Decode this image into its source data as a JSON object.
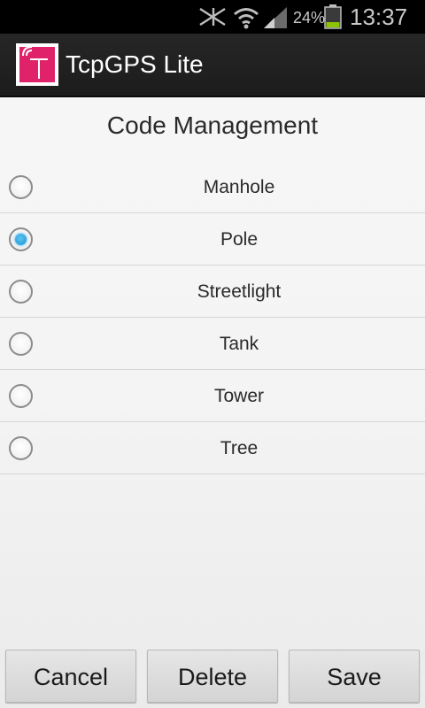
{
  "status_bar": {
    "battery_percent": "24%",
    "time": "13:37",
    "icons": [
      "mute-icon",
      "wifi-icon",
      "signal-icon",
      "battery-icon"
    ]
  },
  "app": {
    "title": "TcpGPS Lite",
    "logo_color": "#e0226a"
  },
  "page": {
    "title": "Code Management"
  },
  "codes": [
    {
      "label": "Manhole",
      "selected": false
    },
    {
      "label": "Pole",
      "selected": true
    },
    {
      "label": "Streetlight",
      "selected": false
    },
    {
      "label": "Tank",
      "selected": false
    },
    {
      "label": "Tower",
      "selected": false
    },
    {
      "label": "Tree",
      "selected": false
    }
  ],
  "buttons": {
    "cancel": "Cancel",
    "delete": "Delete",
    "save": "Save"
  },
  "colors": {
    "accent": "#1696d6",
    "action_bar": "#222222"
  }
}
